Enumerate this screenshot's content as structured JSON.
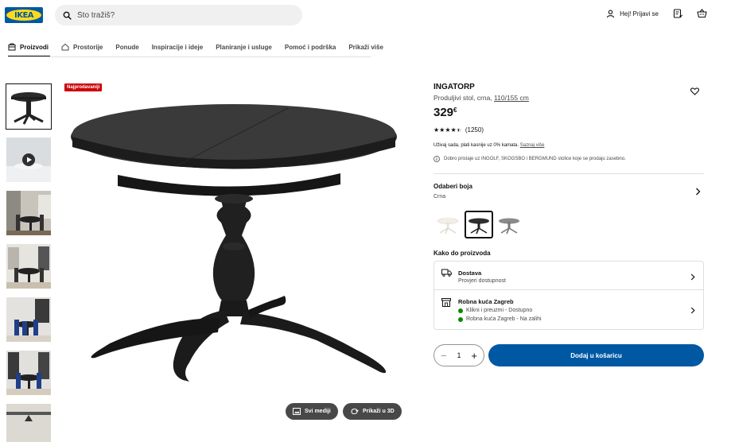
{
  "header": {
    "logo_text": "IKEA",
    "search_placeholder": "Što tražiš?",
    "login_label": "Hej! Prijavi se",
    "icons": [
      "search-icon",
      "user-icon",
      "shopping-list-icon",
      "cart-icon"
    ]
  },
  "nav": {
    "items": [
      {
        "label": "Proizvodi",
        "active": true
      },
      {
        "label": "Prostorije",
        "active": false
      },
      {
        "label": "Ponude",
        "active": false
      },
      {
        "label": "Inspiracije i ideje",
        "active": false
      },
      {
        "label": "Planiranje i usluge",
        "active": false
      },
      {
        "label": "Pomoć i podrška",
        "active": false
      },
      {
        "label": "Prikaži više",
        "active": false
      }
    ]
  },
  "gallery": {
    "badge": "Najprodavaniji",
    "all_media_label": "Svi mediji",
    "view_3d_label": "Prikaži u 3D"
  },
  "product": {
    "name": "INGATORP",
    "description_prefix": "Produljivi stol, crna, ",
    "dimensions": "110/155 cm",
    "price_value": "329",
    "price_currency": "€",
    "rating_stars": 4.5,
    "review_count": "(1250)",
    "pay_text": "Uživaj sada, plati kasnije uz 0% kamata.",
    "pay_link": "Saznaj više",
    "info_text": "Dobro pristaje uz INGOLF, SKOGSBO i BERGMUND stolice koje se prodaju zasebno."
  },
  "color": {
    "title": "Odaberi boja",
    "selected": "Crna"
  },
  "fulfilment": {
    "title": "Kako do proizvoda",
    "delivery_title": "Dostava",
    "delivery_sub": "Provjeri dostupnost",
    "store_title": "Robna kuća Zagreb",
    "store_line1": "Klikni i preuzmi - Dostupno",
    "store_line2": "Robna kuća Zagreb - Na zalihi"
  },
  "purchase": {
    "quantity": "1",
    "add_to_cart": "Dodaj u košaricu"
  },
  "colors": {
    "brand_blue": "#0058a3",
    "brand_yellow": "#ffda1a",
    "badge_red": "#cc0008",
    "stock_green": "#0a8a00"
  }
}
